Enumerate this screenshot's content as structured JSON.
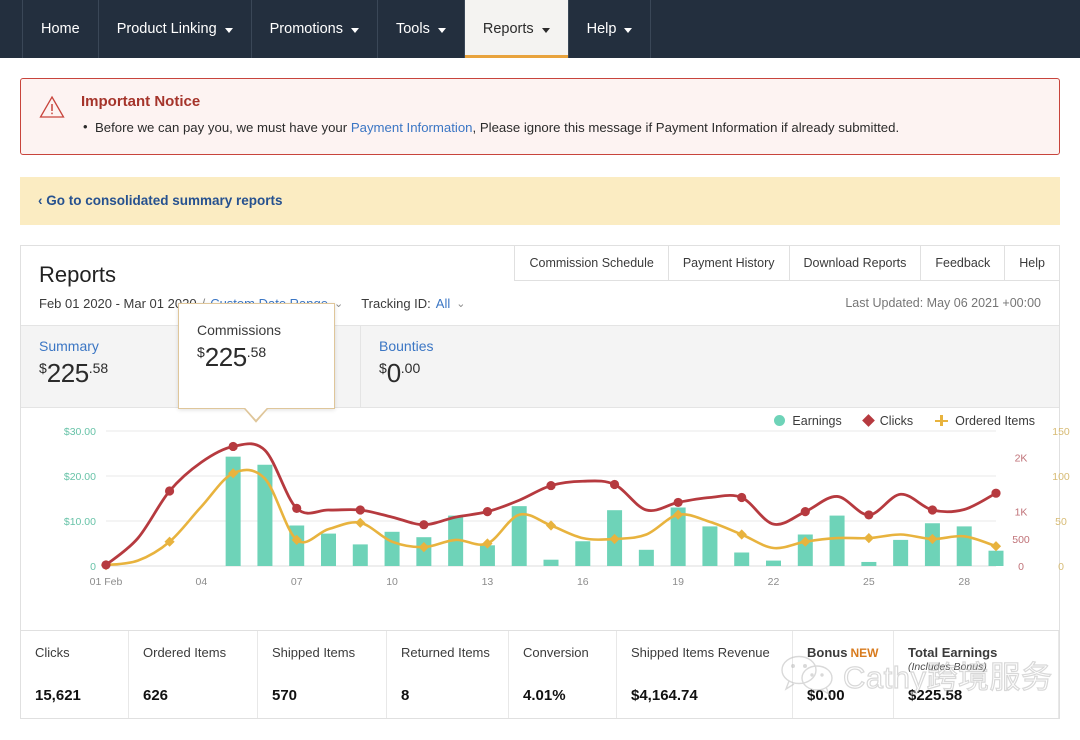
{
  "topnav": {
    "items": [
      {
        "label": "Home",
        "has_caret": false,
        "active": false
      },
      {
        "label": "Product Linking",
        "has_caret": true,
        "active": false
      },
      {
        "label": "Promotions",
        "has_caret": true,
        "active": false
      },
      {
        "label": "Tools",
        "has_caret": true,
        "active": false
      },
      {
        "label": "Reports",
        "has_caret": true,
        "active": true
      },
      {
        "label": "Help",
        "has_caret": true,
        "active": false
      }
    ]
  },
  "notice": {
    "icon": "warning-triangle-icon",
    "title": "Important Notice",
    "bullet_prefix": "Before we can pay you, we must have your ",
    "bullet_link": "Payment Information",
    "bullet_suffix": ", Please ignore this message if Payment Information if already submitted.",
    "border_color": "#c8443c",
    "background_color": "#fdf3f2"
  },
  "consolidated_bar": {
    "chevron": "‹",
    "label": "Go to consolidated summary reports",
    "background_color": "#fbecc2",
    "link_color": "#26518f"
  },
  "report": {
    "title": "Reports",
    "subnav": [
      "Commission Schedule",
      "Payment History",
      "Download Reports",
      "Feedback",
      "Help"
    ],
    "date_range": "Feb 01 2020 - Mar 01 2020",
    "separator": "/",
    "custom_date_range": "Custom Date Range",
    "tracking_id_label": "Tracking ID:",
    "tracking_id_value": "All",
    "last_updated": "Last Updated: May 06 2021 +00:00",
    "caret_glyph": "⌄"
  },
  "summary_tabs": [
    {
      "label": "Summary",
      "currency": "$",
      "whole": "225",
      "cents": ".58",
      "active": false
    },
    {
      "label": "Commissions",
      "currency": "$",
      "whole": "225",
      "cents": ".58",
      "active": true
    },
    {
      "label": "Bounties",
      "currency": "$",
      "whole": "0",
      "cents": ".00",
      "active": false
    }
  ],
  "colors": {
    "earnings": "#6ed3b8",
    "clicks": "#b63a3f",
    "ordered_items": "#e8b33e",
    "nav_bg": "#232f3e",
    "accent_gold": "#e8a33d",
    "link_blue": "#3b76c4"
  },
  "chart_data": {
    "type": "bar",
    "title": "",
    "xlabel": "",
    "grid": true,
    "legend_position": "top-right",
    "legend": [
      "Earnings",
      "Clicks",
      "Ordered Items"
    ],
    "x": [
      "01 Feb",
      "02",
      "03",
      "04",
      "05",
      "06",
      "07",
      "08",
      "09",
      "10",
      "11",
      "12",
      "13",
      "14",
      "15",
      "16",
      "17",
      "18",
      "19",
      "20",
      "21",
      "22",
      "23",
      "24",
      "25",
      "26",
      "27",
      "28",
      "29"
    ],
    "xticks": [
      "01 Feb",
      "04",
      "07",
      "10",
      "13",
      "16",
      "19",
      "22",
      "25",
      "28"
    ],
    "axes": {
      "earnings": {
        "label": "Earnings",
        "ticks": [
          "0",
          "$10.00",
          "$20.00",
          "$30.00"
        ],
        "min": 0,
        "max": 32,
        "color": "#68c3a8"
      },
      "clicks": {
        "label": "Clicks",
        "ticks": [
          "0",
          "500",
          "1K",
          "2K"
        ],
        "min": 0,
        "max": 2650,
        "color": "#c07278"
      },
      "ordered_items": {
        "label": "Ordered Items",
        "ticks": [
          "0",
          "50",
          "100",
          "150"
        ],
        "min": 0,
        "max": 160,
        "color": "#d7bb74"
      }
    },
    "series": [
      {
        "name": "Earnings",
        "type": "bar",
        "axis": "earnings",
        "color": "#6ed3b8",
        "values": [
          0,
          0,
          0,
          0,
          24.3,
          22.5,
          9.0,
          7.2,
          4.8,
          7.6,
          6.4,
          11.2,
          4.6,
          13.3,
          1.4,
          5.5,
          12.4,
          3.6,
          13.0,
          8.8,
          3.0,
          1.2,
          7.0,
          11.2,
          0.9,
          5.8,
          9.5,
          8.8,
          3.4
        ]
      },
      {
        "name": "Clicks",
        "type": "line",
        "axis": "clicks",
        "color": "#b63a3f",
        "values": [
          20,
          510,
          1380,
          1910,
          2200,
          2130,
          1060,
          1030,
          1030,
          900,
          760,
          900,
          1000,
          1210,
          1480,
          1560,
          1500,
          1030,
          1170,
          1260,
          1260,
          770,
          1000,
          1280,
          940,
          1320,
          1030,
          1040,
          1340
        ]
      },
      {
        "name": "Ordered Items",
        "type": "line",
        "axis": "ordered_items",
        "color": "#e8b33e",
        "values": [
          1,
          6,
          27,
          66,
          103,
          97,
          29,
          41,
          48,
          27,
          21,
          29,
          25,
          57,
          45,
          31,
          30,
          35,
          57,
          49,
          35,
          20,
          27,
          31,
          31,
          35,
          30,
          33,
          22
        ]
      }
    ]
  },
  "metrics": [
    {
      "label": "Clicks",
      "value": "15,621",
      "bold_label": false,
      "sub": "",
      "badge": ""
    },
    {
      "label": "Ordered Items",
      "value": "626",
      "bold_label": false,
      "sub": "",
      "badge": ""
    },
    {
      "label": "Shipped Items",
      "value": "570",
      "bold_label": false,
      "sub": "",
      "badge": ""
    },
    {
      "label": "Returned Items",
      "value": "8",
      "bold_label": false,
      "sub": "",
      "badge": ""
    },
    {
      "label": "Conversion",
      "value": "4.01%",
      "bold_label": false,
      "sub": "",
      "badge": ""
    },
    {
      "label": "Shipped Items Revenue",
      "value": "$4,164.74",
      "bold_label": false,
      "sub": "",
      "badge": ""
    },
    {
      "label": "Bonus",
      "value": "$0.00",
      "bold_label": false,
      "sub": "",
      "badge": "NEW"
    },
    {
      "label": "Total Earnings",
      "value": "$225.58",
      "bold_label": true,
      "sub": "(Includes Bonus)",
      "badge": ""
    }
  ],
  "watermark": {
    "icon": "wechat-icon",
    "text": "Cathy跨境服务"
  }
}
